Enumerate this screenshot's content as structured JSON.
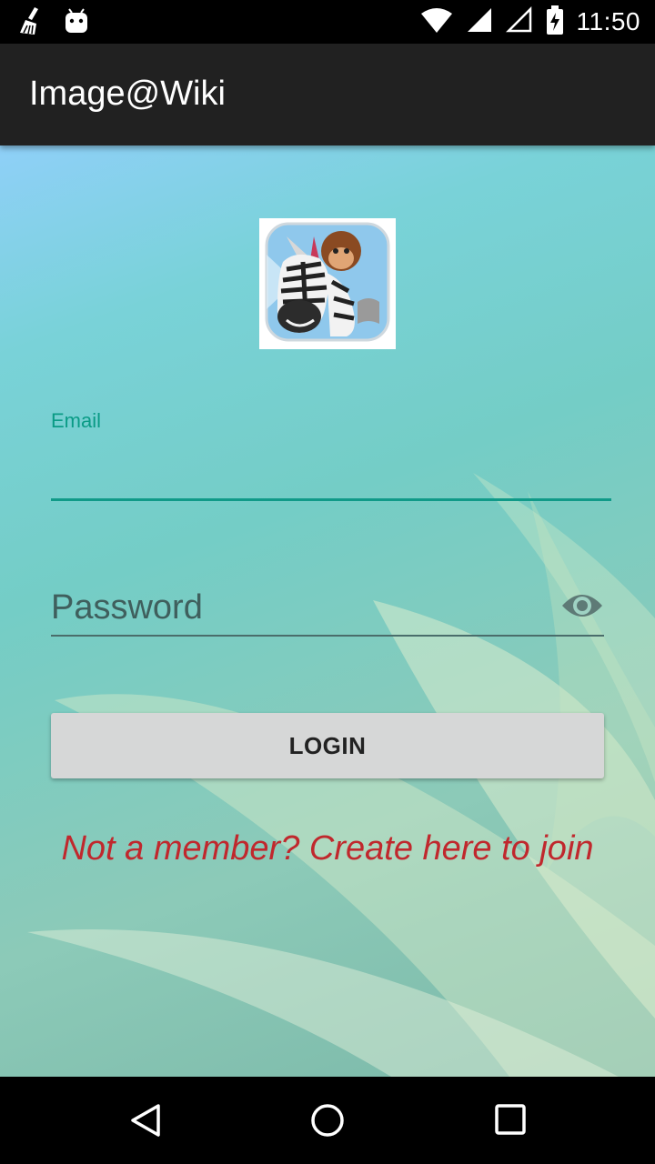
{
  "status_bar": {
    "time": "11:50",
    "icons": [
      "broom-icon",
      "android-icon",
      "wifi-icon",
      "signal-icon",
      "signal-empty-icon",
      "battery-charging-icon"
    ]
  },
  "app_bar": {
    "title": "Image@Wiki"
  },
  "login_form": {
    "logo": "zebra-monkey-app-logo",
    "email_label": "Email",
    "email_value": "",
    "password_placeholder": "Password",
    "password_toggle_icon": "eye-icon",
    "login_button": "LOGIN",
    "signup_link": "Not a member? Create here to join"
  },
  "colors": {
    "accent": "#109a88",
    "link": "#c0282d",
    "app_bar": "#212121",
    "button": "#d6d7d7"
  },
  "nav_bar": {
    "icons": [
      "back-icon",
      "home-icon",
      "recents-icon"
    ]
  }
}
